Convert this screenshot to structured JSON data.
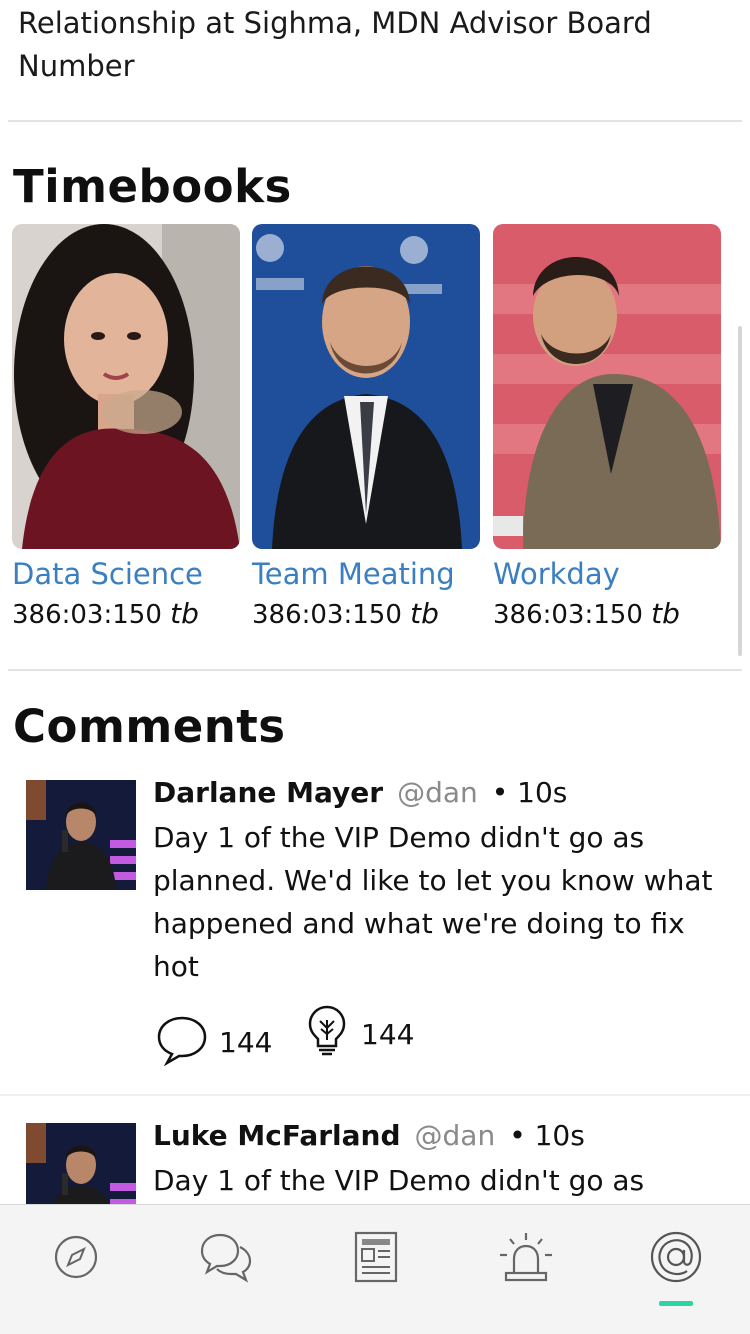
{
  "top_text": "Relationship at Sighma, MDN Advisor Board Number",
  "timebooks": {
    "title": "Timebooks",
    "items": [
      {
        "title": "Data Science",
        "time": "386:03:150",
        "unit": "tb"
      },
      {
        "title": "Team Meating",
        "time": "386:03:150",
        "unit": "tb"
      },
      {
        "title": "Workday",
        "time": "386:03:150",
        "unit": "tb"
      }
    ]
  },
  "comments": {
    "title": "Comments",
    "items": [
      {
        "name": "Darlane Mayer",
        "handle": "@dan",
        "time": "• 10s",
        "text": "Day 1 of the VIP Demo didn't go as planned. We'd like to let you know what happened and what we're doing to fix hot",
        "reply_count": "144",
        "idea_count": "144"
      },
      {
        "name": "Luke McFarland",
        "handle": "@dan",
        "time": "• 10s",
        "text": "Day 1 of the VIP Demo didn't go as"
      }
    ]
  },
  "nav": {
    "items": [
      "compass-icon",
      "chat-icon",
      "newspaper-icon",
      "alarm-icon",
      "at-icon"
    ],
    "active": "at-icon",
    "active_color": "#2bd6a4"
  },
  "colors": {
    "link": "#3a7fc1",
    "handle": "#8a8a8a"
  }
}
